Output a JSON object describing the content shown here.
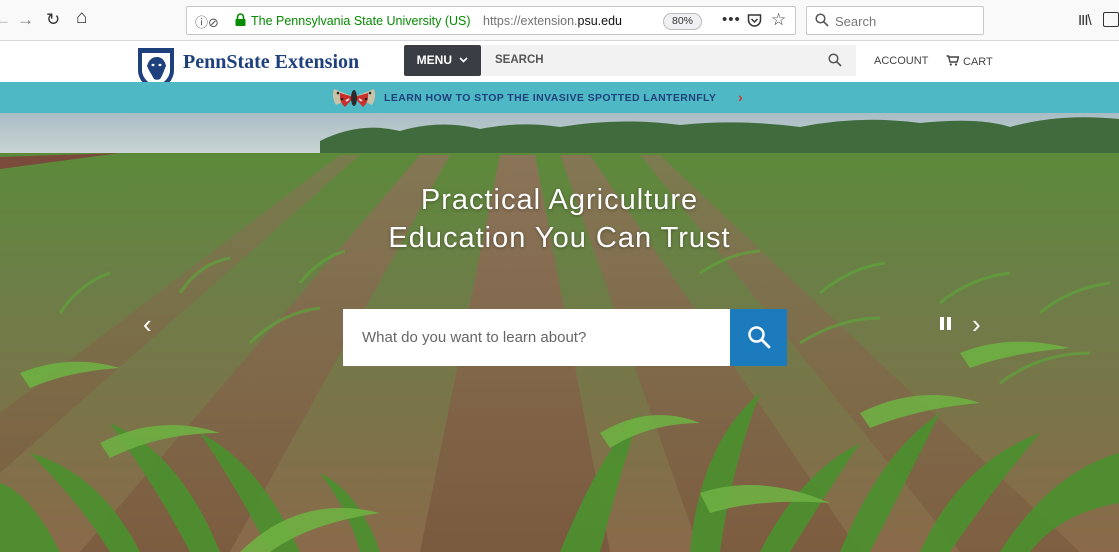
{
  "browser": {
    "nav": {
      "back": "←",
      "forward": "→",
      "reload": "↻",
      "home": "⌂"
    },
    "identity": "The Pennsylvania State University (US)",
    "url_prefix": "https://extension.",
    "url_domain": "psu.edu",
    "zoom": "80%",
    "search_placeholder": "Search",
    "icons": [
      "back-icon",
      "forward-icon",
      "reload-icon",
      "home-icon",
      "info-icon",
      "lock-icon",
      "more-icon",
      "pocket-icon",
      "star-icon",
      "search-icon",
      "library-icon",
      "sidebar-icon"
    ]
  },
  "site": {
    "brand": "PennState Extension",
    "menu_label": "MENU",
    "search_label": "SEARCH",
    "account_label": "ACCOUNT",
    "cart_label": "CART"
  },
  "banner": {
    "text": "LEARN HOW TO STOP THE INVASIVE SPOTTED LANTERNFLY",
    "arrow": "›"
  },
  "hero": {
    "title_line1": "Practical Agriculture",
    "title_line2": "Education You Can Trust",
    "search_placeholder": "What do you want to learn about?",
    "prev": "‹",
    "next": "›"
  },
  "colors": {
    "brand_navy": "#1e407c",
    "banner_teal": "#4fb8c5",
    "search_button_blue": "#1c7bbd",
    "menu_dark": "#3b3d45",
    "banner_arrow_red": "#d9322e",
    "secure_green": "#058b00"
  }
}
